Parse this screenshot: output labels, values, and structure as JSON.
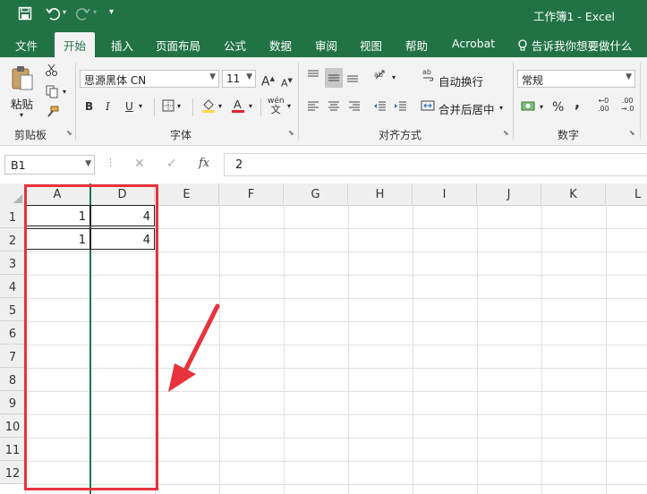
{
  "window": {
    "title": "工作簿1  -  Excel"
  },
  "quick_access": {
    "customize_glyph": "▾"
  },
  "tabs": [
    {
      "label": "文件",
      "active": false
    },
    {
      "label": "开始",
      "active": true
    },
    {
      "label": "插入",
      "active": false
    },
    {
      "label": "页面布局",
      "active": false
    },
    {
      "label": "公式",
      "active": false
    },
    {
      "label": "数据",
      "active": false
    },
    {
      "label": "审阅",
      "active": false
    },
    {
      "label": "视图",
      "active": false
    },
    {
      "label": "帮助",
      "active": false
    },
    {
      "label": "Acrobat",
      "active": false
    }
  ],
  "tell_me": {
    "label": "告诉我你想要做什么"
  },
  "clipboard": {
    "paste_label": "粘贴",
    "group_label": "剪贴板"
  },
  "font": {
    "family": "思源黑体 CN",
    "size": "11",
    "group_label": "字体",
    "bold": "B",
    "italic": "I",
    "underline": "U",
    "grow": "A",
    "shrink": "A",
    "phonetic": "wén"
  },
  "alignment": {
    "wrap_label": "自动换行",
    "merge_label": "合并后居中",
    "group_label": "对齐方式"
  },
  "number": {
    "format": "常规",
    "group_label": "数字",
    "percent": "%",
    "comma": ","
  },
  "formula_bar": {
    "name_box": "B1",
    "fx": "fx",
    "value": "2"
  },
  "sheet": {
    "columns": [
      "A",
      "D",
      "E",
      "F",
      "G",
      "H",
      "I",
      "J",
      "K",
      "L"
    ],
    "rows": [
      "1",
      "2",
      "3",
      "4",
      "5",
      "6",
      "7",
      "8",
      "9",
      "10",
      "11",
      "12"
    ],
    "cells": {
      "A1": "1",
      "D1": "4",
      "A2": "1",
      "D2": "4"
    }
  },
  "colors": {
    "excel_green": "#217346",
    "annotation_red": "#e8323c"
  }
}
